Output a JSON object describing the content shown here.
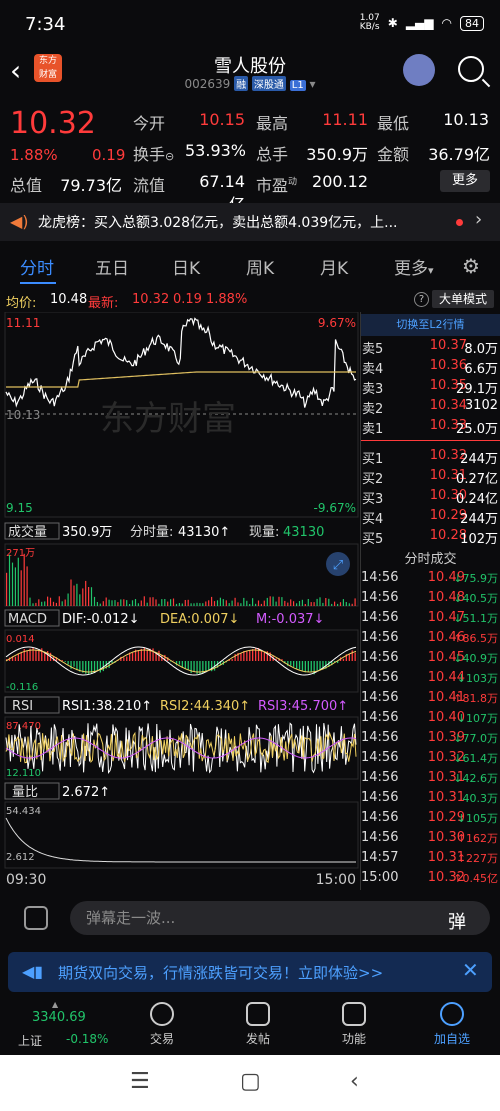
{
  "status_bar": {
    "time": "7:34",
    "speed": "1.07\nKB/s",
    "battery": "84"
  },
  "header": {
    "title": "雪人股份",
    "code": "002639",
    "tags": [
      "融",
      "深股通",
      "L1"
    ]
  },
  "quote": {
    "price": "10.32",
    "change_pct": "1.88%",
    "change": "0.19",
    "open_label": "今开",
    "open": "10.15",
    "high_label": "最高",
    "high": "11.11",
    "low_label": "最低",
    "low": "10.13",
    "turnover_label": "换手",
    "turnover": "53.93%",
    "volume_label": "总手",
    "volume": "350.9万",
    "amount_label": "金额",
    "amount": "36.79亿",
    "mktcap_label": "总值",
    "mktcap": "79.73亿",
    "float_label": "流值",
    "float": "67.14亿",
    "pe_label": "市盈",
    "pe_sup": "动",
    "pe": "200.12",
    "more": "更多"
  },
  "dragon": {
    "text": "龙虎榜：买入总额3.028亿元，卖出总额4.039亿元，上..."
  },
  "tabs": [
    "分时",
    "五日",
    "日K",
    "周K",
    "月K",
    "更多"
  ],
  "chart_info": {
    "avg_label": "均价:",
    "avg": "10.48",
    "last_label": "最新:",
    "last": "10.32",
    "chg": "0.19",
    "pct": "1.88%",
    "bigorder": "大单模式",
    "help": "?"
  },
  "chart_axis": {
    "top": "11.11",
    "mid": "10.13",
    "bottom": "9.15",
    "top_pct": "9.67%",
    "bottom_pct": "-9.67%"
  },
  "watermark": "东方财富",
  "vol_panel": {
    "label": "成交量",
    "total": "350.9万",
    "tick_label": "分时量:",
    "tick": "43130↑",
    "now_label": "现量:",
    "now": "43130",
    "max": "271万"
  },
  "macd": {
    "label": "MACD",
    "dif": "DIF:-0.012↓",
    "dea": "DEA:0.007↓",
    "m": "M:-0.037↓",
    "top": "0.014",
    "bottom": "-0.116"
  },
  "rsi": {
    "label": "RSI",
    "r1": "RSI1:38.210↑",
    "r2": "RSI2:44.340↑",
    "r3": "RSI3:45.700↑",
    "top": "87.470",
    "bottom": "12.110"
  },
  "volratio": {
    "label": "量比",
    "value": "2.672↑",
    "top": "54.434",
    "bottom": "2.612"
  },
  "time_axis": {
    "start": "09:30",
    "end": "15:00"
  },
  "order_book": {
    "switch": "切换至L2行情",
    "asks": [
      {
        "label": "卖5",
        "price": "10.37",
        "vol": "8.0万"
      },
      {
        "label": "卖4",
        "price": "10.36",
        "vol": "6.6万"
      },
      {
        "label": "卖3",
        "price": "10.35",
        "vol": "29.1万"
      },
      {
        "label": "卖2",
        "price": "10.34",
        "vol": "3102"
      },
      {
        "label": "卖1",
        "price": "10.33",
        "vol": "25.0万"
      }
    ],
    "bids": [
      {
        "label": "买1",
        "price": "10.32",
        "vol": "244万"
      },
      {
        "label": "买2",
        "price": "10.31",
        "vol": "0.27亿"
      },
      {
        "label": "买3",
        "price": "10.30",
        "vol": "0.24亿"
      },
      {
        "label": "买4",
        "price": "10.29",
        "vol": "244万"
      },
      {
        "label": "买5",
        "price": "10.28",
        "vol": "102万"
      }
    ]
  },
  "ticks": {
    "title": "分时成交",
    "rows": [
      {
        "t": "14:56",
        "p": "10.49",
        "v": "↓75.9万",
        "c": "red",
        "vc": "green"
      },
      {
        "t": "14:56",
        "p": "10.48",
        "v": "↓40.5万",
        "c": "red",
        "vc": "green"
      },
      {
        "t": "14:56",
        "p": "10.47",
        "v": "↓51.1万",
        "c": "red",
        "vc": "green"
      },
      {
        "t": "14:56",
        "p": "10.46",
        "v": "↑86.5万",
        "c": "red",
        "vc": "red"
      },
      {
        "t": "14:56",
        "p": "10.45",
        "v": "↓40.9万",
        "c": "red",
        "vc": "green"
      },
      {
        "t": "14:56",
        "p": "10.44",
        "v": "↓103万",
        "c": "red",
        "vc": "green"
      },
      {
        "t": "14:56",
        "p": "10.41",
        "v": "↑81.8万",
        "c": "red",
        "vc": "red"
      },
      {
        "t": "14:56",
        "p": "10.40",
        "v": "↓107万",
        "c": "red",
        "vc": "green"
      },
      {
        "t": "14:56",
        "p": "10.39",
        "v": "↓77.0万",
        "c": "red",
        "vc": "green"
      },
      {
        "t": "14:56",
        "p": "10.32",
        "v": "↓61.4万",
        "c": "red",
        "vc": "green"
      },
      {
        "t": "14:56",
        "p": "10.31",
        "v": "↓42.6万",
        "c": "red",
        "vc": "green"
      },
      {
        "t": "14:56",
        "p": "10.31",
        "v": "40.3万",
        "c": "red",
        "vc": "green"
      },
      {
        "t": "14:56",
        "p": "10.29",
        "v": "↓105万",
        "c": "red",
        "vc": "green"
      },
      {
        "t": "14:56",
        "p": "10.30",
        "v": "↑162万",
        "c": "red",
        "vc": "red"
      },
      {
        "t": "14:57",
        "p": "10.31",
        "v": "↑227万",
        "c": "red",
        "vc": "red"
      },
      {
        "t": "15:00",
        "p": "10.32",
        "v": "↑0.45亿",
        "c": "red",
        "vc": "red"
      }
    ]
  },
  "comment": {
    "placeholder": "弹幕走一波...",
    "danmu": "弹"
  },
  "ad": {
    "text": "期货双向交易，行情涨跌皆可交易！立即体验>>"
  },
  "bottom_nav": {
    "index_name": "上证",
    "index_value": "3340.69",
    "index_pct": "-0.18%",
    "items": [
      "交易",
      "发帖",
      "功能",
      "加自选"
    ]
  }
}
